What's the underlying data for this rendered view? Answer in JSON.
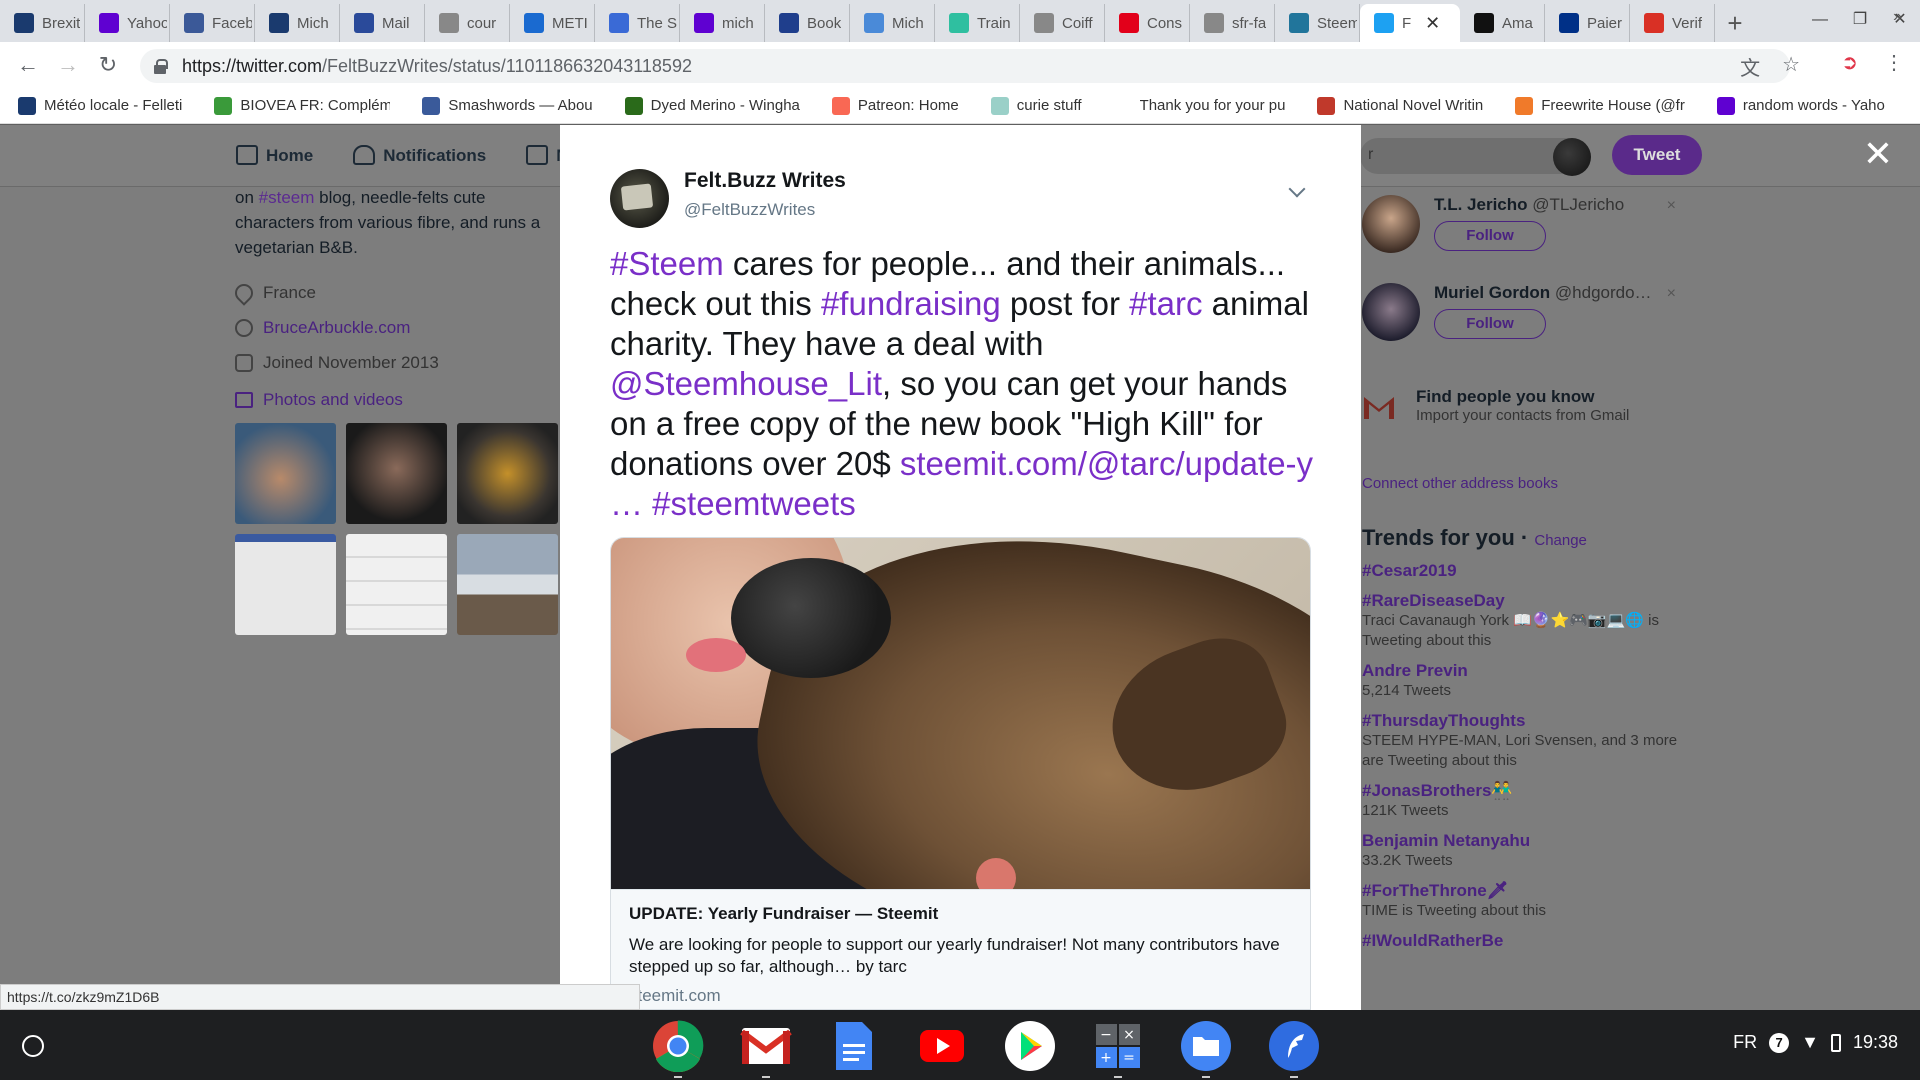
{
  "browser": {
    "tabs": [
      {
        "label": "Brexit",
        "icon": "steem-icon",
        "color": "#1a3a6e"
      },
      {
        "label": "Yahoo",
        "icon": "yahoo-icon",
        "color": "#5f01d1"
      },
      {
        "label": "Facebook",
        "icon": "facebook-icon",
        "color": "#3b5998"
      },
      {
        "label": "Mich",
        "icon": "steem-icon",
        "color": "#1a3a6e"
      },
      {
        "label": "Mail",
        "icon": "mail-icon",
        "color": "#2a4a9a"
      },
      {
        "label": "cour",
        "icon": "doc-icon",
        "color": "#888888"
      },
      {
        "label": "METI",
        "icon": "steem-icon",
        "color": "#1a6ad0"
      },
      {
        "label": "The S",
        "icon": "wikipedia-icon",
        "color": "#3a6ad6"
      },
      {
        "label": "mich",
        "icon": "yahoo-icon",
        "color": "#5f01d1"
      },
      {
        "label": "Book",
        "icon": "booking-icon",
        "color": "#1f3e8c"
      },
      {
        "label": "Mich",
        "icon": "steem-icon",
        "color": "#4a8ad8"
      },
      {
        "label": "Train",
        "icon": "trainline-icon",
        "color": "#2fbfa0"
      },
      {
        "label": "Coiff",
        "icon": "doc-icon",
        "color": "#888888"
      },
      {
        "label": "Cons",
        "icon": "sfr-icon",
        "color": "#e2001a"
      },
      {
        "label": "sfr-fa",
        "icon": "doc-icon",
        "color": "#888888"
      },
      {
        "label": "Steem",
        "icon": "wordpress-icon",
        "color": "#21759b"
      },
      {
        "label": "F",
        "icon": "twitter-icon",
        "color": "#1da1f2",
        "active": true
      },
      {
        "label": "Ama",
        "icon": "amazon-icon",
        "color": "#111111"
      },
      {
        "label": "Paier",
        "icon": "paypal-icon",
        "color": "#003087"
      },
      {
        "label": "Verif",
        "icon": "gmail-icon",
        "color": "#d93025"
      }
    ],
    "new_tab": "+",
    "close_tab": "✕",
    "url_host": "https://twitter.com",
    "url_path": "/FeltBuzzWrites/status/1101186632043118592",
    "bookmarks": [
      {
        "label": "Météo locale - Felleti",
        "icon": "steem-icon",
        "color": "#1a3a6e"
      },
      {
        "label": "BIOVEA FR: Complém",
        "icon": "biovea-icon",
        "color": "#3a9a3a"
      },
      {
        "label": "Smashwords — Abou",
        "icon": "smashwords-icon",
        "color": "#3a5a9a"
      },
      {
        "label": "Dyed Merino - Wingha",
        "icon": "leaf-icon",
        "color": "#2a6a1a"
      },
      {
        "label": "Patreon: Home",
        "icon": "patreon-icon",
        "color": "#f96854"
      },
      {
        "label": "curie stuff",
        "icon": "curie-icon",
        "color": "#9ad0c8"
      },
      {
        "label": "Thank you for your pu",
        "icon": "blank-icon",
        "color": "#ffffff"
      },
      {
        "label": "National Novel Writin",
        "icon": "nanowrimo-icon",
        "color": "#c0392b"
      },
      {
        "label": "Freewrite House (@fr",
        "icon": "freewrite-icon",
        "color": "#f07a2a"
      },
      {
        "label": "random words - Yaho",
        "icon": "yahoo-icon",
        "color": "#5f01d1"
      }
    ],
    "bookmarks_more": "»",
    "status_url": "https://t.co/zkz9mZ1D6B"
  },
  "twitter": {
    "nav": [
      {
        "label": "Home",
        "icon": "home-icon"
      },
      {
        "label": "Notifications",
        "icon": "bell-icon"
      },
      {
        "label": "Me",
        "icon": "messages-icon"
      }
    ],
    "search_partial": "r",
    "tweet_button": "Tweet",
    "close_label": "✕",
    "profile": {
      "bio_prefix": "on ",
      "bio_hashtag": "#steem",
      "bio_rest": " blog, needle-felts cute characters from various fibre, and runs a vegetarian B&B.",
      "location": "France",
      "website": "BruceArbuckle.com",
      "joined": "Joined November 2013",
      "photos_label": "Photos and videos"
    },
    "who_to_follow": [
      {
        "name": "T.L. Jericho",
        "handle": "@TLJericho",
        "follow": "Follow"
      },
      {
        "name": "Muriel Gordon",
        "handle": "@hdgordo…",
        "follow": "Follow"
      }
    ],
    "find_people": {
      "title": "Find people you know",
      "subtitle": "Import your contacts from Gmail"
    },
    "connect_label": "Connect other address books",
    "trends_title": "Trends for you",
    "trends_change": "Change",
    "trends": [
      {
        "name": "#Cesar2019",
        "sub": ""
      },
      {
        "name": "#RareDiseaseDay",
        "sub": "Traci Cavanaugh York 📖🔮⭐🎮📷💻🌐 is Tweeting about this"
      },
      {
        "name": "Andre Previn",
        "sub": "5,214 Tweets"
      },
      {
        "name": "#ThursdayThoughts",
        "sub": "STEEM HYPE-MAN, Lori Svensen, and 3 more are Tweeting about this"
      },
      {
        "name": "#JonasBrothers👬",
        "sub": "121K Tweets"
      },
      {
        "name": "Benjamin Netanyahu",
        "sub": "33.2K Tweets"
      },
      {
        "name": "#ForTheThrone🗡",
        "sub": "TIME is Tweeting about this"
      },
      {
        "name": "#IWouldRatherBe",
        "sub": ""
      }
    ]
  },
  "tweet": {
    "author_name": "Felt.Buzz Writes",
    "author_handle": "@FeltBuzzWrites",
    "text_parts": {
      "h1": "#Steem",
      "t1": " cares for people... and their animals... check out this ",
      "h2": "#fundraising",
      "t2": " post for ",
      "h3": "#tarc",
      "t3": " animal charity. They have a deal with ",
      "h4": "@Steemhouse_Lit",
      "t4": ", so you can get your hands on a free copy of the new book \"High Kill\" for donations over 20$ ",
      "h5": "steemit.com/@tarc/update-y …",
      "t5": " ",
      "h6": "#steemtweets"
    },
    "card": {
      "title": "UPDATE: Yearly Fundraiser — Steemit",
      "description": "We are looking for people to support our yearly fundraiser! Not many contributors have stepped up so far, although… by tarc",
      "domain": "steemit.com"
    }
  },
  "shelf": {
    "apps": [
      {
        "name": "chrome-icon"
      },
      {
        "name": "gmail-icon"
      },
      {
        "name": "docs-icon"
      },
      {
        "name": "youtube-icon"
      },
      {
        "name": "play-store-icon"
      },
      {
        "name": "calculator-icon"
      },
      {
        "name": "files-icon"
      },
      {
        "name": "feedback-icon"
      }
    ],
    "language": "FR",
    "notifications": "7",
    "time": "19:38"
  }
}
